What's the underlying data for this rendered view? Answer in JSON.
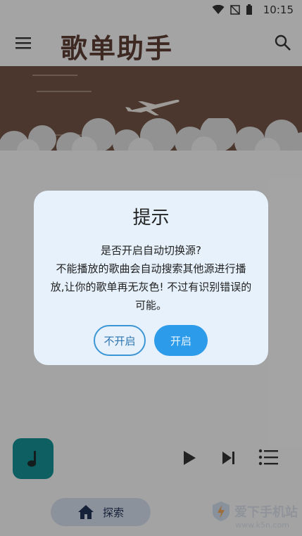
{
  "status_bar": {
    "time": "10:15"
  },
  "app_bar": {
    "title": "歌单助手"
  },
  "player": {
    "album_icon": "music-note-icon"
  },
  "bottom_nav": {
    "explore_label": "探索"
  },
  "watermark": {
    "text": "爱下手机站",
    "url_text": "www.k5n.com"
  },
  "dialog": {
    "title": "提示",
    "message_line1": "是否开启自动切换源?",
    "message_line2": "不能播放的歌曲会自动搜索其他源进行播",
    "message_line3": "放,让你的歌单再无灰色! 不过有识别错误的",
    "message_line4": "可能。",
    "cancel_label": "不开启",
    "confirm_label": "开启"
  },
  "colors": {
    "accent": "#2c9be9",
    "banner": "#6f5243",
    "title": "#5a3d33",
    "album": "#148c8f"
  }
}
